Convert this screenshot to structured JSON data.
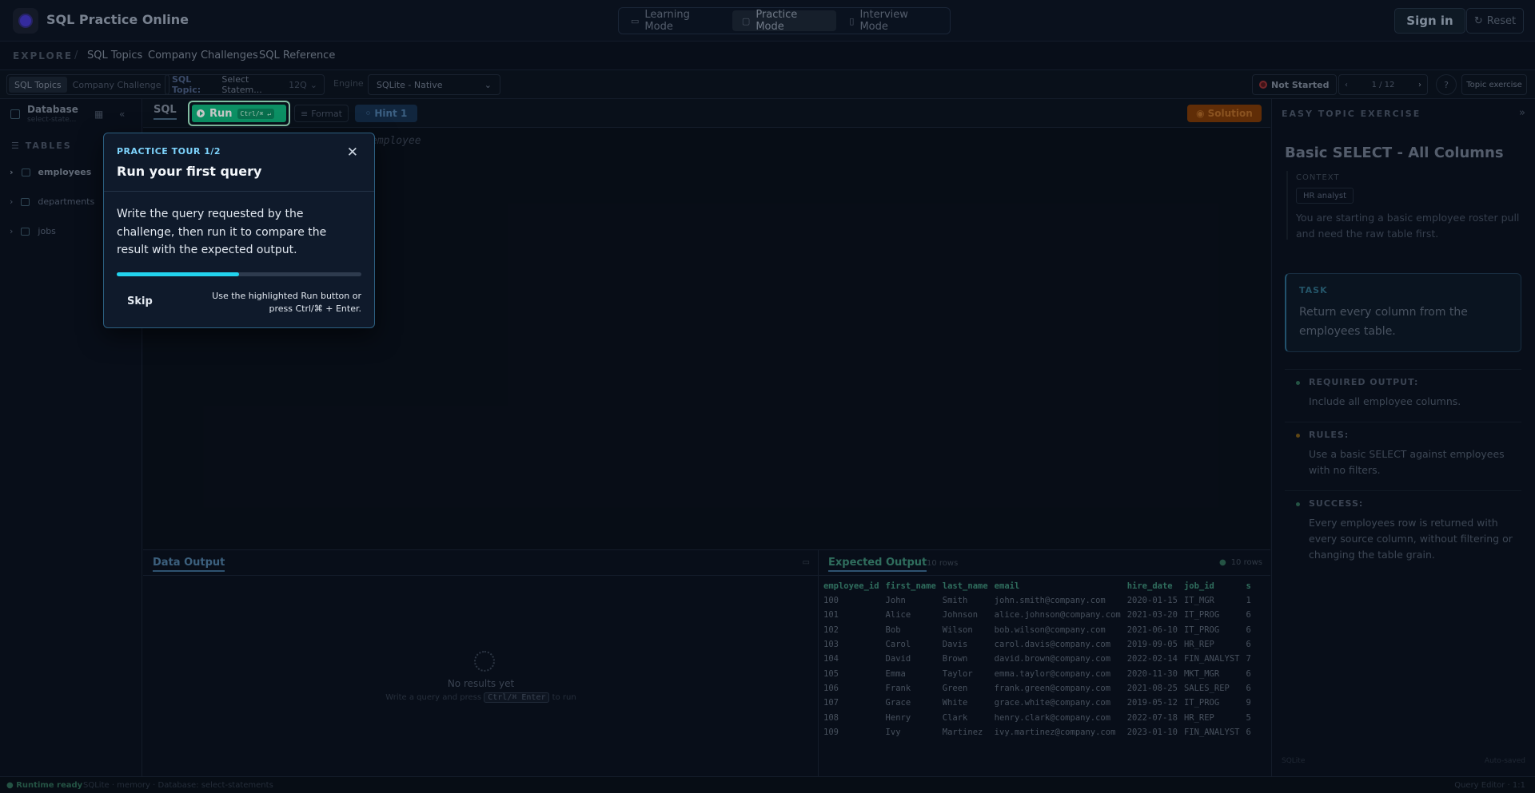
{
  "header": {
    "app_title": "SQL Practice Online",
    "modes": [
      "Learning Mode",
      "Practice Mode",
      "Interview Mode"
    ],
    "active_mode": "Practice Mode",
    "sign_in": "Sign in",
    "reset": "Reset"
  },
  "explore": {
    "label": "EXPLORE",
    "separator": "/",
    "links": [
      "SQL Topics",
      "Company Challenges",
      "SQL Reference"
    ]
  },
  "toolbar": {
    "tabs": [
      "SQL Topics",
      "Company Challenge"
    ],
    "topic_key": "SQL Topic:",
    "topic_value": "Select Statem...",
    "topic_count": "12Q",
    "engine_label": "Engine",
    "engine_value": "SQLite - Native",
    "status": "Not Started",
    "pager": "1 / 12",
    "topic_exercise": "Topic exercise"
  },
  "sidebar": {
    "title": "Database",
    "subtitle": "select-state...",
    "tables_heading": "TABLES",
    "tables": [
      "employees",
      "departments",
      "jobs"
    ]
  },
  "editor": {
    "tab": "SQL",
    "run_label": "Run",
    "run_shortcut": "Ctrl/⌘ ↵",
    "format_label": "Format",
    "hint_label": "Hint 1",
    "solution_label": "Solution",
    "placeholder": "employee"
  },
  "data_output": {
    "title": "Data Output",
    "empty_title": "No results yet",
    "empty_pre": "Write a query and press",
    "empty_kbd": "Ctrl/⌘ Enter",
    "empty_post": "to run"
  },
  "expected_output": {
    "title": "Expected Output",
    "rows_label": "10 rows",
    "columns": [
      "employee_id",
      "first_name",
      "last_name",
      "email",
      "hire_date",
      "job_id",
      "s"
    ],
    "rows": [
      [
        "100",
        "John",
        "Smith",
        "john.smith@company.com",
        "2020-01-15",
        "IT_MGR",
        "1"
      ],
      [
        "101",
        "Alice",
        "Johnson",
        "alice.johnson@company.com",
        "2021-03-20",
        "IT_PROG",
        "6"
      ],
      [
        "102",
        "Bob",
        "Wilson",
        "bob.wilson@company.com",
        "2021-06-10",
        "IT_PROG",
        "6"
      ],
      [
        "103",
        "Carol",
        "Davis",
        "carol.davis@company.com",
        "2019-09-05",
        "HR_REP",
        "6"
      ],
      [
        "104",
        "David",
        "Brown",
        "david.brown@company.com",
        "2022-02-14",
        "FIN_ANALYST",
        "7"
      ],
      [
        "105",
        "Emma",
        "Taylor",
        "emma.taylor@company.com",
        "2020-11-30",
        "MKT_MGR",
        "6"
      ],
      [
        "106",
        "Frank",
        "Green",
        "frank.green@company.com",
        "2021-08-25",
        "SALES_REP",
        "6"
      ],
      [
        "107",
        "Grace",
        "White",
        "grace.white@company.com",
        "2019-05-12",
        "IT_PROG",
        "9"
      ],
      [
        "108",
        "Henry",
        "Clark",
        "henry.clark@company.com",
        "2022-07-18",
        "HR_REP",
        "5"
      ],
      [
        "109",
        "Ivy",
        "Martinez",
        "ivy.martinez@company.com",
        "2023-01-10",
        "FIN_ANALYST",
        "6"
      ]
    ]
  },
  "exercise": {
    "heading": "EASY TOPIC EXERCISE",
    "title": "Basic SELECT - All Columns",
    "context_label": "CONTEXT",
    "context_badge": "HR analyst",
    "context_text": "You are starting a basic employee roster pull and need the raw table first.",
    "task_label": "TASK",
    "task_text": "Return every column from the employees table.",
    "sections": [
      {
        "heading": "REQUIRED OUTPUT:",
        "text": "Include all employee columns.",
        "color": "#2f6b58"
      },
      {
        "heading": "RULES:",
        "text": "Use a basic SELECT against employees with no filters.",
        "color": "#7a5a1a"
      },
      {
        "heading": "SUCCESS:",
        "text": "Every employees row is returned with every source column, without filtering or changing the table grain.",
        "color": "#2f6b58"
      }
    ],
    "footer_left": "SQLite",
    "footer_right": "Auto-saved"
  },
  "statusbar": {
    "ok": "Runtime ready",
    "rest": "SQLite · memory · Database: select-statements",
    "right": "Query Editor · 1:1"
  },
  "tour": {
    "step": "PRACTICE TOUR 1/2",
    "title": "Run your first query",
    "body": "Write the query requested by the challenge, then run it to compare the result with the expected output.",
    "progress": 0.5,
    "skip": "Skip",
    "note": "Use the highlighted Run button or press Ctrl/⌘ + Enter.",
    "accent": "#22d3ee"
  }
}
